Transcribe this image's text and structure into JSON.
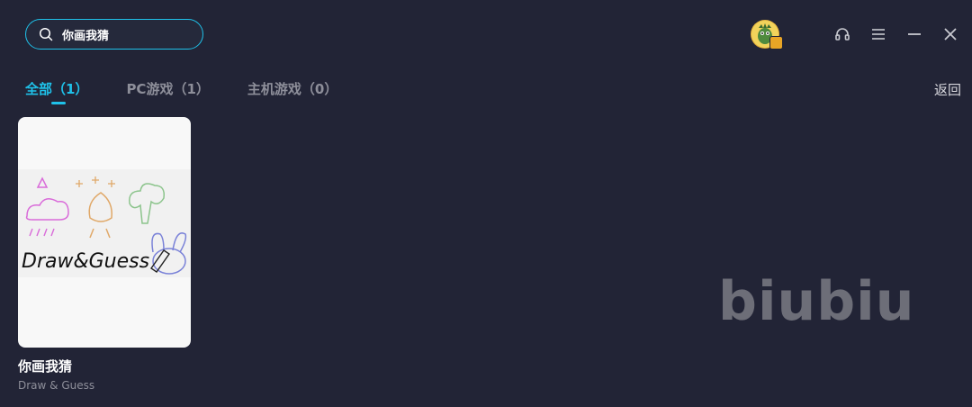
{
  "search": {
    "value": "你画我猜",
    "icon": "search-icon"
  },
  "toolbar": {
    "icons": [
      "avatar",
      "headset-icon",
      "menu-icon",
      "minimize-icon",
      "close-icon"
    ],
    "accent": "#1fc1e9"
  },
  "tabs": [
    {
      "label": "全部（1）",
      "active": true
    },
    {
      "label": "PC游戏（1）",
      "active": false
    },
    {
      "label": "主机游戏（0）",
      "active": false
    }
  ],
  "back_label": "返回",
  "results": [
    {
      "title": "你画我猜",
      "subtitle": "Draw & Guess",
      "cover_text": "Draw&Guess"
    }
  ],
  "watermark": "biubiu"
}
